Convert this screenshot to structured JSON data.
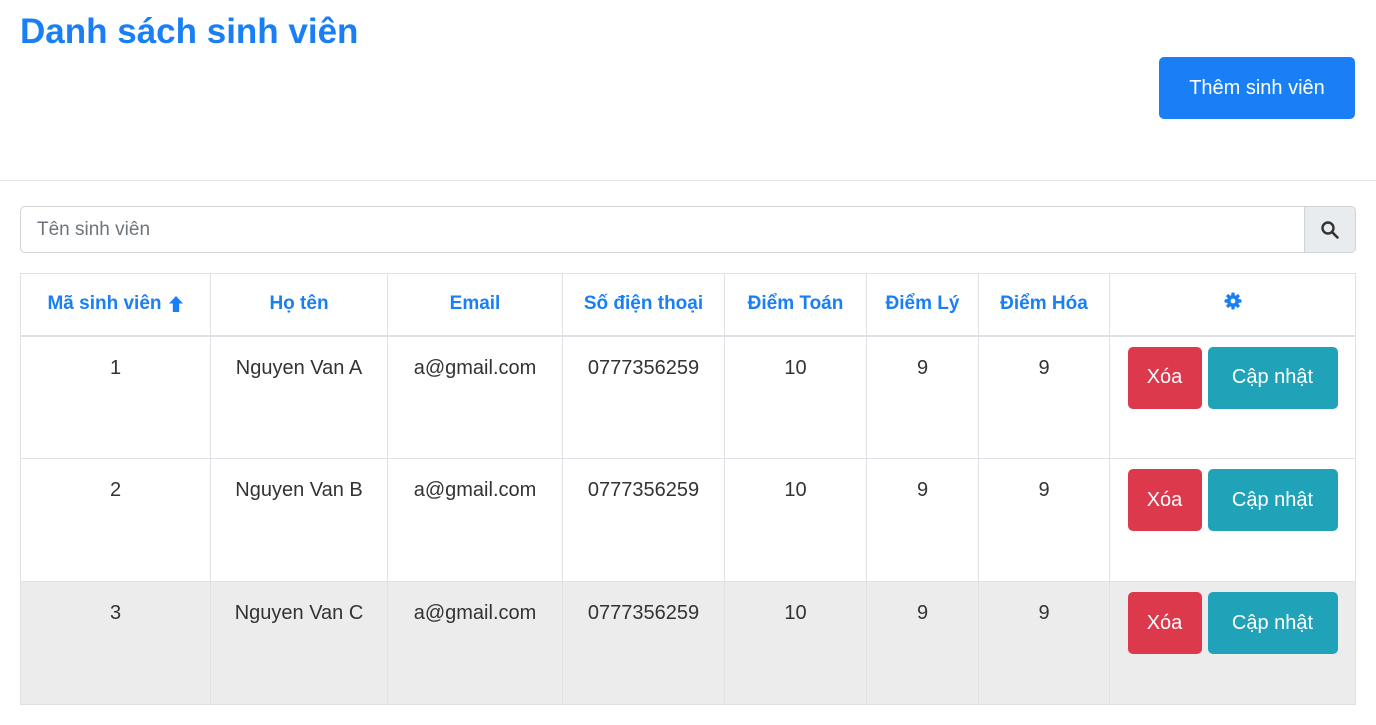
{
  "page": {
    "title": "Danh sách sinh viên",
    "add_button_label": "Thêm sinh viên"
  },
  "search": {
    "placeholder": "Tên sinh viên",
    "value": "",
    "icon": "search-icon"
  },
  "table": {
    "headers": {
      "id": "Mã sinh viên",
      "name": "Họ tên",
      "email": "Email",
      "phone": "Số điện thoại",
      "math": "Điểm Toán",
      "physics": "Điểm Lý",
      "chemistry": "Điểm Hóa",
      "actions_icon": "gear-icon"
    },
    "sort": {
      "column": "id",
      "direction": "ascending",
      "icon": "arrow-up-icon"
    },
    "rows": [
      {
        "id": "1",
        "name": "Nguyen Van A",
        "email": "a@gmail.com",
        "phone": "0777356259",
        "math": "10",
        "physics": "9",
        "chemistry": "9",
        "delete_label": "Xóa",
        "update_label": "Cập nhật"
      },
      {
        "id": "2",
        "name": "Nguyen Van B",
        "email": "a@gmail.com",
        "phone": "0777356259",
        "math": "10",
        "physics": "9",
        "chemistry": "9",
        "delete_label": "Xóa",
        "update_label": "Cập nhật"
      },
      {
        "id": "3",
        "name": "Nguyen Van C",
        "email": "a@gmail.com",
        "phone": "0777356259",
        "math": "10",
        "physics": "9",
        "chemistry": "9",
        "delete_label": "Xóa",
        "update_label": "Cập nhật"
      }
    ]
  },
  "colors": {
    "primary": "#1a7ff5",
    "danger": "#dc3a4c",
    "info": "#20a3b8",
    "highlight_row": "#ececec"
  }
}
